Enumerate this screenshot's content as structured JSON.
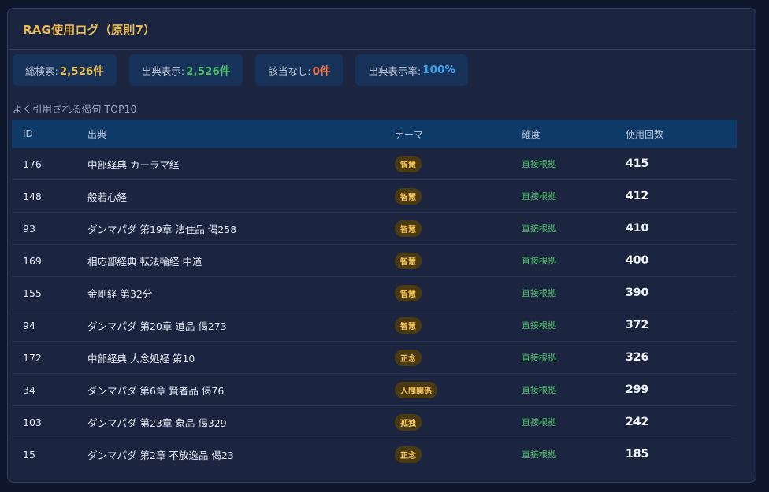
{
  "panel": {
    "title": "RAG使用ログ（原則7）"
  },
  "stats": [
    {
      "label": "総検索:",
      "value": "2,526件",
      "color": "#e7b951"
    },
    {
      "label": "出典表示:",
      "value": "2,526件",
      "color": "#4fbf6b"
    },
    {
      "label": "該当なし:",
      "value": "0件",
      "color": "#f2744f"
    },
    {
      "label": "出典表示率:",
      "value": "100%",
      "color": "#3aa6ee"
    }
  ],
  "section_label": "よく引用される偈句 TOP10",
  "table": {
    "headers": {
      "id": "ID",
      "source": "出典",
      "theme": "テーマ",
      "confidence": "確度",
      "count": "使用回数"
    },
    "rows": [
      {
        "id": "176",
        "source": "中部経典 カーラマ経",
        "theme": "智慧",
        "confidence": "直接根拠",
        "count": "415"
      },
      {
        "id": "148",
        "source": "般若心経",
        "theme": "智慧",
        "confidence": "直接根拠",
        "count": "412"
      },
      {
        "id": "93",
        "source": "ダンマパダ 第19章 法住品 偈258",
        "theme": "智慧",
        "confidence": "直接根拠",
        "count": "410"
      },
      {
        "id": "169",
        "source": "相応部経典 転法輪経 中道",
        "theme": "智慧",
        "confidence": "直接根拠",
        "count": "400"
      },
      {
        "id": "155",
        "source": "金剛経 第32分",
        "theme": "智慧",
        "confidence": "直接根拠",
        "count": "390"
      },
      {
        "id": "94",
        "source": "ダンマパダ 第20章 道品 偈273",
        "theme": "智慧",
        "confidence": "直接根拠",
        "count": "372"
      },
      {
        "id": "172",
        "source": "中部経典 大念処経 第10",
        "theme": "正念",
        "confidence": "直接根拠",
        "count": "326"
      },
      {
        "id": "34",
        "source": "ダンマパダ 第6章 賢者品 偈76",
        "theme": "人間関係",
        "confidence": "直接根拠",
        "count": "299"
      },
      {
        "id": "103",
        "source": "ダンマパダ 第23章 象品 偈329",
        "theme": "孤独",
        "confidence": "直接根拠",
        "count": "242"
      },
      {
        "id": "15",
        "source": "ダンマパダ 第2章 不放逸品 偈23",
        "theme": "正念",
        "confidence": "直接根拠",
        "count": "185"
      }
    ]
  }
}
